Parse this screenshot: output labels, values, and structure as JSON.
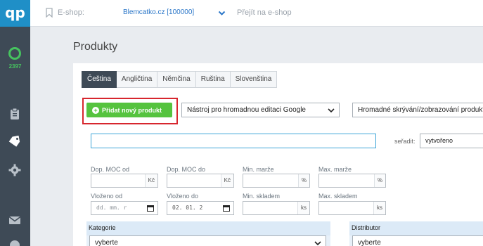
{
  "sidebar": {
    "logo": "qp",
    "counter": "2397",
    "icons": [
      "clipboard-icon",
      "tag-icon",
      "gear-icon",
      "mail-icon"
    ]
  },
  "topbar": {
    "eshop_label": "E-shop:",
    "eshop_value": "Blemcatko.cz [100000]",
    "go_eshop": "Přejít na e-shop"
  },
  "page": {
    "title": "Produkty"
  },
  "tabs": [
    "Čeština",
    "Angličtina",
    "Němčina",
    "Ruština",
    "Slovenština"
  ],
  "active_tab": "Čeština",
  "toolbar": {
    "add_product": "Přidat nový produkt",
    "google_tool": "Nástroj pro hromadnou editaci Google",
    "bulk_visibility": "Hromadné skrývání/zobrazování produktů"
  },
  "search": {
    "value": ""
  },
  "sort": {
    "label": "seřadit:",
    "value": "vytvořeno"
  },
  "filters": {
    "row1": [
      {
        "label": "Dop. MOC od",
        "unit": "Kč"
      },
      {
        "label": "Dop. MOC do",
        "unit": "Kč"
      },
      {
        "label": "Min. marže",
        "unit": "%"
      },
      {
        "label": "Max. marže",
        "unit": "%"
      }
    ],
    "row2": [
      {
        "label": "Vloženo od",
        "value": "dd. mm. r"
      },
      {
        "label": "Vloženo do",
        "value": "02. 01. 2"
      },
      {
        "label": "Min. skladem",
        "unit": "ks"
      },
      {
        "label": "Max. skladem",
        "unit": "ks"
      }
    ]
  },
  "sections": {
    "category": {
      "label": "Kategorie",
      "value": "vyberte"
    },
    "distributor": {
      "label": "Distributor",
      "value": "vyberte"
    }
  },
  "colors": {
    "accent": "#1f8fc7",
    "sidebar": "#3e4a56",
    "add_button": "#55c33e",
    "highlight": "#d7262e"
  }
}
